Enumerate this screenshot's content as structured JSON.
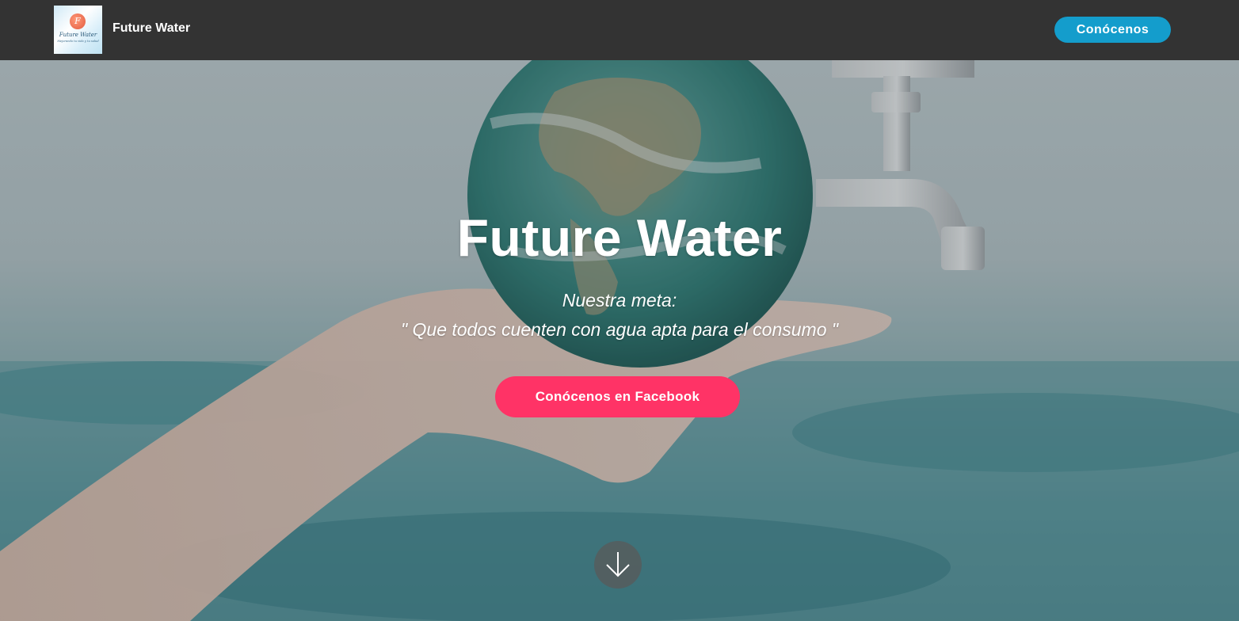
{
  "header": {
    "logo": {
      "letter": "F",
      "name": "Future Water",
      "slogan": "Mejorando tu vida y tu salud"
    },
    "brand": "Future Water",
    "nav_button": "Conócenos"
  },
  "hero": {
    "title": "Future Water",
    "subtitle_line1": "Nuestra meta:",
    "subtitle_line2": "\" Que todos cuenten con agua apta para el consumo \"",
    "cta_button": "Conócenos en Facebook",
    "scroll_icon": "arrow-down-icon"
  },
  "colors": {
    "header_bg": "#333333",
    "nav_button_bg": "#149dcc",
    "cta_button_bg": "#ff3366",
    "text": "#ffffff"
  }
}
